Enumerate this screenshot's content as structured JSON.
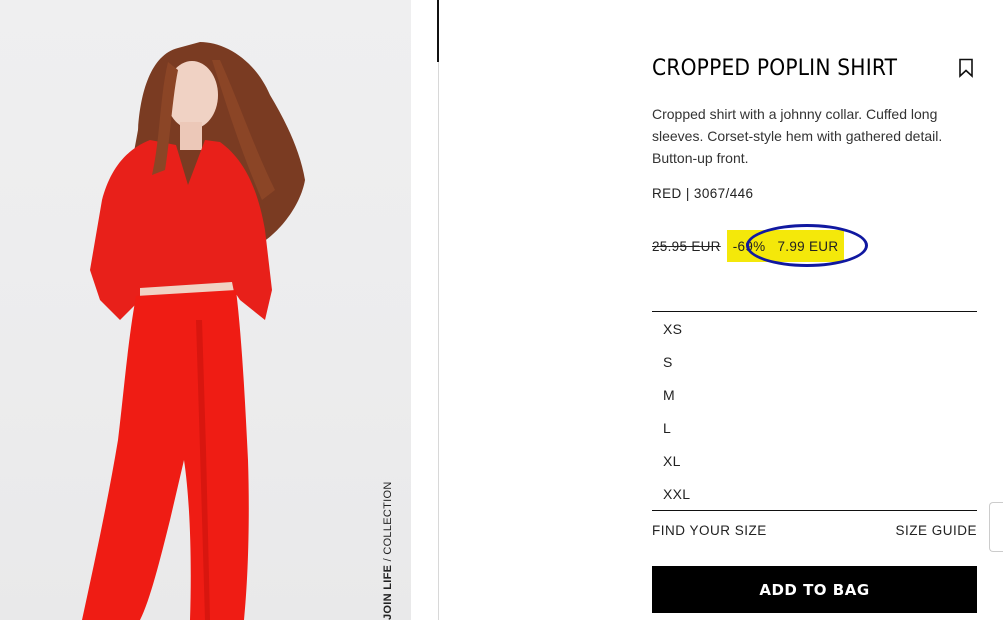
{
  "image": {
    "alt_icon": "product-photo",
    "collection_bold": "JOIN LIFE",
    "collection_rest": " / COLLECTION"
  },
  "product": {
    "title": "CROPPED POPLIN SHIRT",
    "description": "Cropped shirt with a johnny collar. Cuffed long sleeves. Corset-style hem with gathered detail. Button-up front.",
    "color_ref": "RED | 3067/446",
    "old_price": "25.95 EUR",
    "discount": "-69%",
    "price": "7.99 EUR"
  },
  "sizes": [
    "XS",
    "S",
    "M",
    "L",
    "XL",
    "XXL"
  ],
  "size_help": {
    "find_label": "FIND YOUR SIZE",
    "guide_label": "SIZE GUIDE"
  },
  "cta": {
    "add_label": "ADD TO BAG"
  },
  "colors": {
    "sale_highlight": "#f4e80a",
    "annotation": "#1018a0",
    "cta_bg": "#000000"
  }
}
